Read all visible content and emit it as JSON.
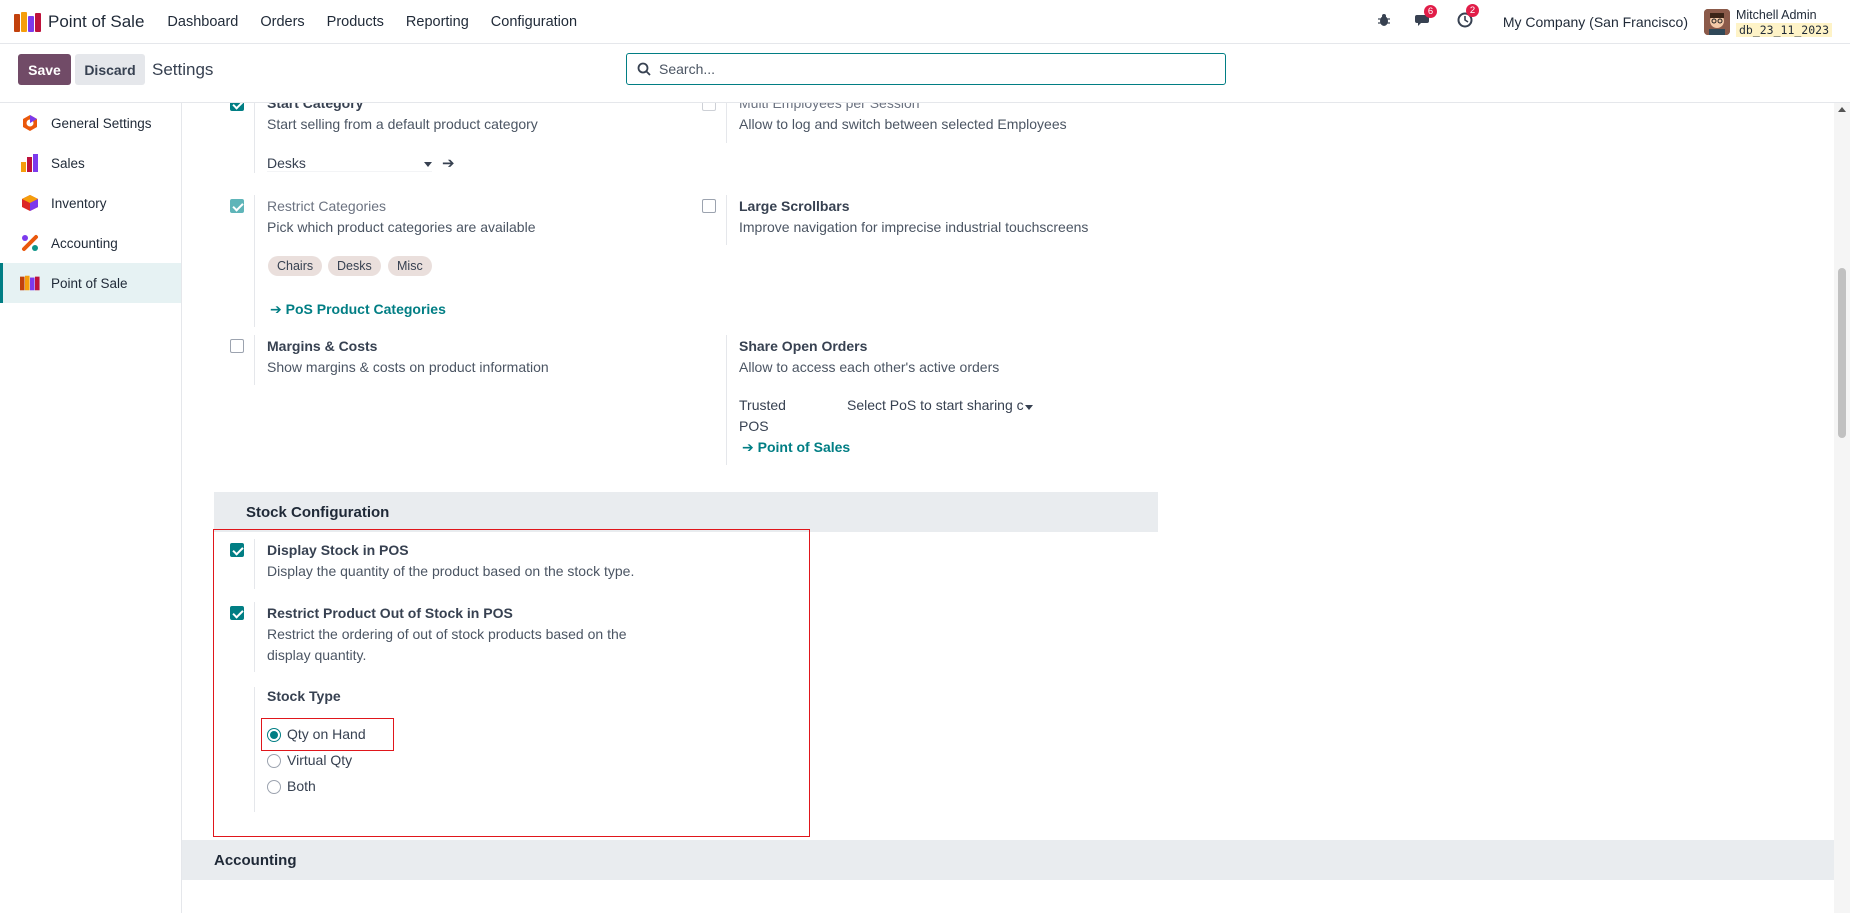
{
  "navbar": {
    "app_title": "Point of Sale",
    "menu": [
      "Dashboard",
      "Orders",
      "Products",
      "Reporting",
      "Configuration"
    ],
    "messages_count": "6",
    "activities_count": "2",
    "company": "My Company (San Francisco)",
    "user_name": "Mitchell Admin",
    "database": "db_23_11_2023"
  },
  "control": {
    "save_label": "Save",
    "discard_label": "Discard",
    "breadcrumb": "Settings",
    "search_placeholder": "Search..."
  },
  "sidebar": {
    "items": [
      {
        "label": "General Settings",
        "icon": "general-settings-icon"
      },
      {
        "label": "Sales",
        "icon": "sales-icon"
      },
      {
        "label": "Inventory",
        "icon": "inventory-icon"
      },
      {
        "label": "Accounting",
        "icon": "accounting-icon"
      },
      {
        "label": "Point of Sale",
        "icon": "point-of-sale-icon",
        "active": true
      }
    ]
  },
  "settings": {
    "start_category": {
      "title": "Start Category",
      "desc": "Start selling from a default product category",
      "value": "Desks",
      "checked": true
    },
    "multi_employees": {
      "title": "Multi Employees per Session",
      "desc": "Allow to log and switch between selected Employees",
      "checked": false
    },
    "restrict_categories": {
      "title": "Restrict Categories",
      "desc": "Pick which product categories are available",
      "tags": [
        "Chairs",
        "Desks",
        "Misc"
      ],
      "link": "PoS Product Categories",
      "checked": true
    },
    "large_scrollbars": {
      "title": "Large Scrollbars",
      "desc": "Improve navigation for imprecise industrial touchscreens",
      "checked": false
    },
    "margins_costs": {
      "title": "Margins & Costs",
      "desc": "Show margins & costs on product information",
      "checked": false
    },
    "share_orders": {
      "title": "Share Open Orders",
      "desc": "Allow to access each other's active orders",
      "trusted_label_1": "Trusted",
      "trusted_label_2": "POS",
      "trusted_placeholder": "Select PoS to start sharing c",
      "link": "Point of Sales"
    }
  },
  "stock": {
    "section_title": "Stock Configuration",
    "display_stock": {
      "title": "Display Stock in POS",
      "desc": "Display the quantity of the product based on the stock type.",
      "checked": true
    },
    "restrict_oos": {
      "title": "Restrict Product Out of Stock in POS",
      "desc_1": "Restrict the ordering of out of stock products based on the",
      "desc_2": "display quantity.",
      "checked": true
    },
    "stock_type_label": "Stock Type",
    "options": [
      "Qty on Hand",
      "Virtual Qty",
      "Both"
    ],
    "selected": "Qty on Hand"
  },
  "accounting_section": "Accounting",
  "colors": {
    "primary": "#714b67",
    "teal": "#017e84",
    "highlight": "#e0161b"
  }
}
